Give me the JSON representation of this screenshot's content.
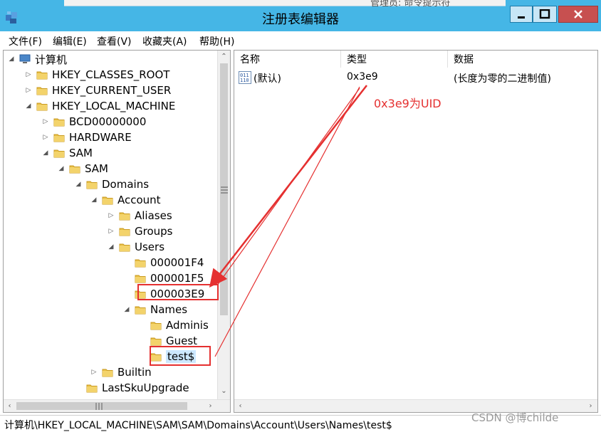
{
  "window": {
    "title": "注册表编辑器",
    "background_title_fragment": "管理员: 命令提示符"
  },
  "menu": [
    "文件(F)",
    "编辑(E)",
    "查看(V)",
    "收藏夹(A)",
    "帮助(H)"
  ],
  "tree": [
    {
      "label": "计算机",
      "expanded": true
    },
    {
      "label": "HKEY_CLASSES_ROOT",
      "expanded": false
    },
    {
      "label": "HKEY_CURRENT_USER",
      "expanded": false
    },
    {
      "label": "HKEY_LOCAL_MACHINE",
      "expanded": true
    },
    {
      "label": "BCD00000000",
      "expanded": false
    },
    {
      "label": "HARDWARE",
      "expanded": false
    },
    {
      "label": "SAM",
      "expanded": true
    },
    {
      "label": "SAM",
      "expanded": true
    },
    {
      "label": "Domains",
      "expanded": true
    },
    {
      "label": "Account",
      "expanded": true
    },
    {
      "label": "Aliases",
      "expanded": false
    },
    {
      "label": "Groups",
      "expanded": false
    },
    {
      "label": "Users",
      "expanded": true
    },
    {
      "label": "000001F4",
      "expanded": null
    },
    {
      "label": "000001F5",
      "expanded": null
    },
    {
      "label": "000003E9",
      "expanded": null
    },
    {
      "label": "Names",
      "expanded": true
    },
    {
      "label": "Adminis",
      "expanded": null
    },
    {
      "label": "Guest",
      "expanded": null
    },
    {
      "label": "test$",
      "expanded": null,
      "selected": true
    },
    {
      "label": "Builtin",
      "expanded": false
    },
    {
      "label": "LastSkuUpgrade",
      "expanded": null
    }
  ],
  "list": {
    "columns": [
      "名称",
      "类型",
      "数据"
    ],
    "rows": [
      {
        "name": "(默认)",
        "type": "0x3e9",
        "data": "(长度为零的二进制值)"
      }
    ]
  },
  "annotation": "0x3e9为UID",
  "status_path": "计算机\\HKEY_LOCAL_MACHINE\\SAM\\SAM\\Domains\\Account\\Users\\Names\\test$",
  "watermark": "CSDN @博childe",
  "colors": {
    "titlebar": "#45b6e6",
    "close_button": "#c75050",
    "annotation_red": "#e53030",
    "selection": "#cce8ff",
    "folder": "#e8bf45"
  }
}
